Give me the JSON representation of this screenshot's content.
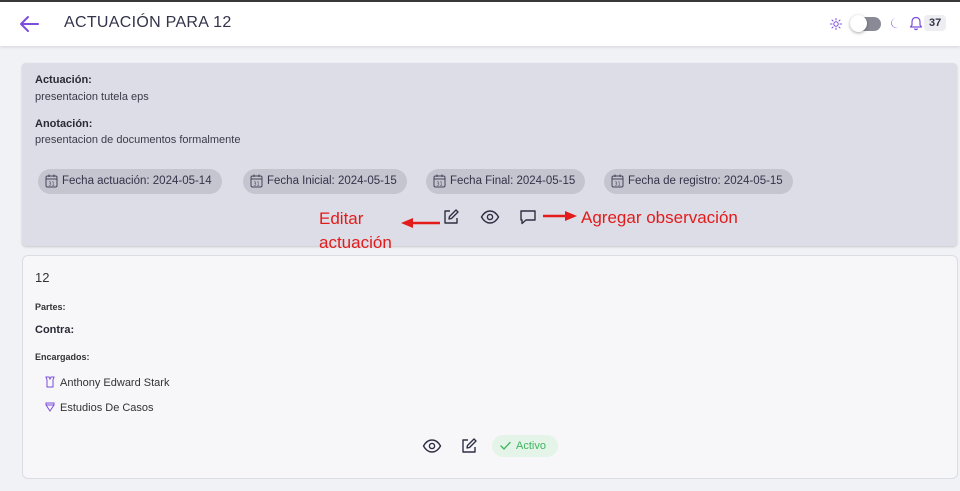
{
  "header": {
    "title": "ACTUACIÓN PARA 12",
    "notification_count": "37",
    "icons": [
      "arrow-left-icon",
      "sun-icon",
      "theme-toggle",
      "moon-icon",
      "bell-icon"
    ]
  },
  "actuacion_card": {
    "actuacion_label": "Actuación:",
    "actuacion_value": "presentacion tutela eps",
    "anotacion_label": "Anotación:",
    "anotacion_value": "presentacion de documentos formalmente",
    "chips": [
      {
        "label": "Fecha actuación: 2024-05-14"
      },
      {
        "label": "Fecha Inicial: 2024-05-15"
      },
      {
        "label": "Fecha Final: 2024-05-15"
      },
      {
        "label": "Fecha de registro: 2024-05-15"
      }
    ]
  },
  "annotations": {
    "edit_line1": "Editar",
    "edit_line2": "actuación",
    "observation": "Agregar observación",
    "color": "#e31b1b"
  },
  "process_card": {
    "number": "12",
    "partes_label": "Partes:",
    "contra_label": "Contra:",
    "encargados_label": "Encargados:",
    "encargados": [
      {
        "name": "Anthony Edward Stark",
        "icon": "user-tie-icon"
      },
      {
        "name": "Estudios De Casos",
        "icon": "diamond-icon"
      }
    ],
    "status": "Activo"
  },
  "colors": {
    "accent": "#7c4ddb",
    "card_bg": "#dcdde6",
    "chip_bg": "#c4c5cf",
    "status_green": "#3eb55e"
  }
}
